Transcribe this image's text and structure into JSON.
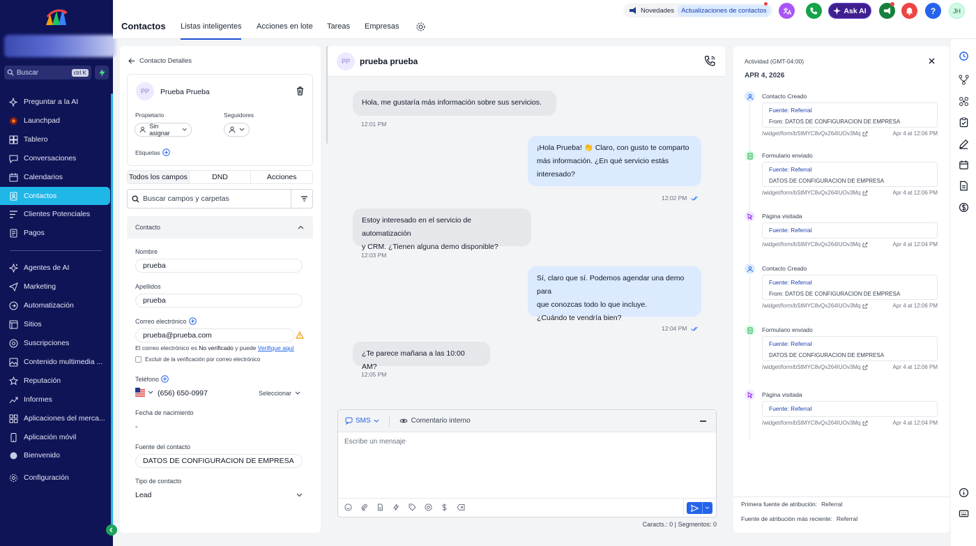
{
  "sidebar": {
    "search_label": "Buscar",
    "search_shortcut": "ctrl K",
    "items": [
      {
        "label": "Preguntar a la AI",
        "icon": "sparkle-icon"
      },
      {
        "label": "Launchpad",
        "icon": "rocket-icon"
      },
      {
        "label": "Tablero",
        "icon": "dashboard-icon"
      },
      {
        "label": "Conversaciones",
        "icon": "chat-icon"
      },
      {
        "label": "Calendarios",
        "icon": "calendar-icon"
      },
      {
        "label": "Contactos",
        "icon": "contacts-icon",
        "active": true
      },
      {
        "label": "Clientes Potenciales",
        "icon": "opportunities-icon"
      },
      {
        "label": "Pagos",
        "icon": "payments-icon"
      },
      {
        "label": "Agentes de AI",
        "icon": "ai-agent-icon"
      },
      {
        "label": "Marketing",
        "icon": "send-icon"
      },
      {
        "label": "Automatización",
        "icon": "automation-icon"
      },
      {
        "label": "Sitios",
        "icon": "sites-icon"
      },
      {
        "label": "Suscripciones",
        "icon": "subscriptions-icon"
      },
      {
        "label": "Contenido multimedia ...",
        "icon": "media-icon"
      },
      {
        "label": "Reputación",
        "icon": "star-icon"
      },
      {
        "label": "Informes",
        "icon": "reports-icon"
      },
      {
        "label": "Aplicaciones del merca...",
        "icon": "apps-icon"
      },
      {
        "label": "Aplicación móvil",
        "icon": "mobile-icon"
      },
      {
        "label": "Bienvenido",
        "icon": "welcome-icon"
      },
      {
        "label": "Configuración",
        "icon": "settings-icon"
      }
    ]
  },
  "topbar": {
    "title": "Contactos",
    "tabs": [
      "Listas inteligentes",
      "Acciones en lote",
      "Tareas",
      "Empresas"
    ],
    "news_label": "Novedades",
    "news_update": "Actualizaciones de contactos",
    "ask_ai": "Ask AI",
    "user_initials": "JH",
    "colors": {
      "purple": "#7c3aed",
      "green": "#16a34a",
      "red": "#ef4444",
      "blue": "#2563eb",
      "teal": "#15803d"
    }
  },
  "contact": {
    "back_label": "Contacto Detalles",
    "initials": "PP",
    "name": "Prueba Prueba",
    "owner_label": "Propietario",
    "owner_value": "Sin asignar",
    "followers_label": "Seguidores",
    "tags_label": "Etiquetas",
    "tabs": [
      "Todos los campos",
      "DND",
      "Acciones"
    ],
    "field_search_placeholder": "Buscar campos y carpetas",
    "section": "Contacto",
    "first_name_label": "Nombre",
    "first_name": "prueba",
    "last_name_label": "Apellidos",
    "last_name": "prueba",
    "email_label": "Correo electrónico",
    "email": "prueba@prueba.com",
    "email_note_1": "El correo electrónico es ",
    "email_note_bold": "No verificado",
    "email_note_2": " y puede ",
    "email_verify_link": "Verifique aquí",
    "email_exclude": "Excluir de la verificación por correo electrónico",
    "phone_label": "Teléfono",
    "phone": "(656) 650-0997",
    "phone_select": "Seleccionar",
    "dob_label": "Fecha de nacimiento",
    "dob_value": "-",
    "source_label": "Fuente del contacto",
    "source_value": "DATOS DE CONFIGURACION DE EMPRESA",
    "type_label": "Tipo de contacto",
    "type_value": "Lead"
  },
  "conversation": {
    "initials": "PP",
    "name": "prueba prueba",
    "messages": [
      {
        "dir": "in",
        "lines": [
          "Hola, me gustaría más información sobre sus servicios."
        ],
        "time": "12:01 PM"
      },
      {
        "dir": "out",
        "lines": [
          "¡Hola Prueba! 👏 Claro, con gusto te comparto",
          "más información. ¿En qué servicio estás",
          "interesado?"
        ],
        "time": "12:02 PM"
      },
      {
        "dir": "in",
        "lines": [
          "Estoy interesado en el servicio de automatización",
          "y CRM. ¿Tienen alguna demo disponible?"
        ],
        "time": "12:03 PM"
      },
      {
        "dir": "out",
        "lines": [
          "Sí, claro que sí. Podemos agendar una demo para",
          "que conozcas todo lo que incluye.",
          "¿Cuándo te vendría bien?"
        ],
        "time": "12:04 PM"
      },
      {
        "dir": "in",
        "lines": [
          "¿Te parece mañana a las 10:00 AM?"
        ],
        "time": "12:05 PM"
      }
    ],
    "channel": "SMS",
    "internal_comment": "Comentario interno",
    "placeholder": "Escribe un mensaje",
    "counter": "Caracts.: 0 | Segmentos: 0"
  },
  "activity": {
    "title": "Actividad (GMT-04:00)",
    "date": "APR 4, 2026",
    "items": [
      {
        "type": "Contacto Creado",
        "icon": "user-icon",
        "source": "Fuente: Referral",
        "from": "From: DATOS DE CONFIGURACION DE EMPRESA",
        "url": "/widget/form/bStMYC8vQx264IUOv3Mq",
        "time": "Apr 4 at 12:06 PM"
      },
      {
        "type": "Formulario enviado",
        "icon": "form-icon",
        "source": "Fuente: Referral",
        "from": "DATOS DE CONFIGURACION DE EMPRESA",
        "url": "/widget/form/bStMYC8vQx264IUOv3Mq",
        "time": "Apr 4 at 12:06 PM"
      },
      {
        "type": "Página visitada",
        "icon": "pointer-icon",
        "source": "Fuente: Referral",
        "from": "",
        "url": "/widget/form/bStMYC8vQx264IUOv3Mq",
        "time": "Apr 4 at 12:04 PM"
      },
      {
        "type": "Contacto Creado",
        "icon": "user-icon",
        "source": "Fuente: Referral",
        "from": "From: DATOS DE CONFIGURACION DE EMPRESA",
        "url": "/widget/form/bStMYC8vQx264IUOv3Mq",
        "time": "Apr 4 at 12:06 PM"
      },
      {
        "type": "Formulario enviado",
        "icon": "form-icon",
        "source": "Fuente: Referral",
        "from": "DATOS DE CONFIGURACION DE EMPRESA",
        "url": "/widget/form/bStMYC8vQx264IUOv3Mq",
        "time": "Apr 4 at 12:06 PM"
      },
      {
        "type": "Página visitada",
        "icon": "pointer-icon",
        "source": "Fuente: Referral",
        "from": "",
        "url": "/widget/form/bStMYC8vQx264IUOv3Mq",
        "time": "Apr 4 at 12:04 PM"
      }
    ],
    "first_attr_label": "Primera fuente de atribución:",
    "first_attr_value": "Referral",
    "latest_attr_label": "Fuente de atribución más reciente:",
    "latest_attr_value": "Referral"
  }
}
